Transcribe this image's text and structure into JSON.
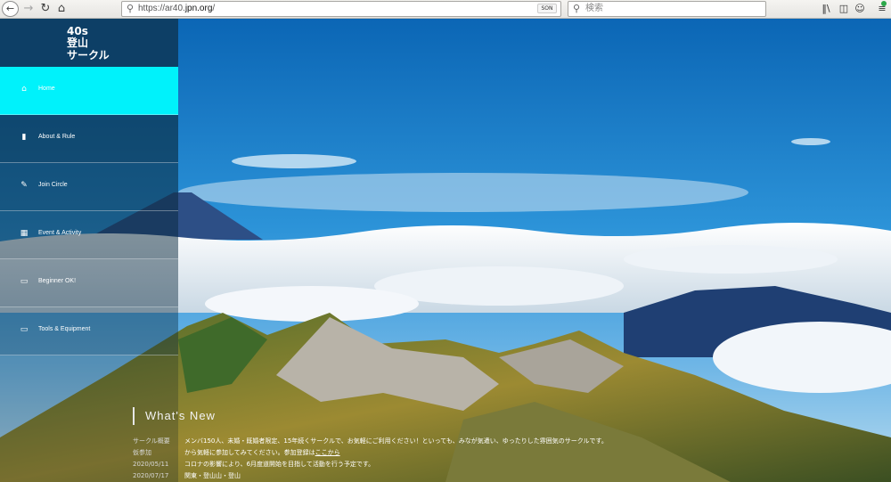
{
  "browser": {
    "url_prefix": "https://ar40.",
    "url_domain": "jpn.org",
    "url_suffix": "/",
    "url_badge": "SON",
    "search_placeholder": "検索",
    "icons": {
      "back": "back-arrow-icon",
      "forward": "forward-arrow-icon",
      "reload": "reload-icon",
      "home": "home-icon",
      "library": "library-icon",
      "sidebar": "sidebar-icon",
      "account": "account-icon",
      "menu": "hamburger-menu-icon"
    }
  },
  "site": {
    "brand_line1": "40s",
    "brand_line2": "登山",
    "brand_line3": "サークル",
    "colors": {
      "brand_bg": "#0d3f66",
      "active_nav": "#00f2fb"
    },
    "nav": [
      {
        "label": "Home",
        "icon": "home-icon"
      },
      {
        "label": "About & Rule",
        "icon": "bookmark-icon"
      },
      {
        "label": "Join Circle",
        "icon": "pencil-icon"
      },
      {
        "label": "Event & Activity",
        "icon": "calendar-icon"
      },
      {
        "label": "Beginner OK!",
        "icon": "monitor-icon"
      },
      {
        "label": "Tools & Equipment",
        "icon": "monitor-icon"
      }
    ]
  },
  "news": {
    "title": "What's New",
    "items": [
      {
        "date": "サークル概要",
        "text_before": "メンバ150人、未婚・既婚者限定、15年続くサークルで、お気軽にご利用ください！といっても、みなが気遣い、ゆったりした雰囲気のサークルです。",
        "link": "",
        "text_after": ""
      },
      {
        "date": "仮参加",
        "text_before": "から気軽に参加してみてください。参加登録は",
        "link": "ここから",
        "text_after": ""
      },
      {
        "date": "2020/05/11",
        "text_before": "コロナの影響により、6月度道開始を目指して活動を行う予定です。",
        "link": "",
        "text_after": ""
      },
      {
        "date": "2020/07/17",
        "text_before": "関東・登山山・登山",
        "link": "",
        "text_after": ""
      }
    ]
  }
}
